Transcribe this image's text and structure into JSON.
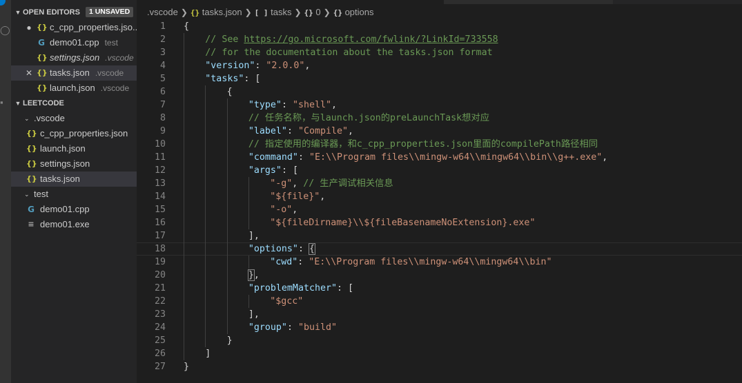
{
  "sidebar": {
    "open_editors": {
      "title": "OPEN EDITORS",
      "badge": "1 UNSAVED",
      "items": [
        {
          "label": "c_cpp_properties.jso...",
          "desc": ""
        },
        {
          "label": "demo01.cpp",
          "desc": "test"
        },
        {
          "label": "settings.json",
          "desc": ".vscode"
        },
        {
          "label": "tasks.json",
          "desc": ".vscode"
        },
        {
          "label": "launch.json",
          "desc": ".vscode"
        }
      ]
    },
    "workspace": {
      "title": "LEETCODE",
      "folders": [
        {
          "label": ".vscode",
          "files": [
            "c_cpp_properties.json",
            "launch.json",
            "settings.json",
            "tasks.json"
          ]
        },
        {
          "label": "test",
          "files": [
            "demo01.cpp",
            "demo01.exe"
          ]
        }
      ]
    }
  },
  "breadcrumbs": [
    ".vscode",
    "tasks.json",
    "tasks",
    "0",
    "options"
  ],
  "icons": {
    "json": "braces-icon",
    "cpp": "cpp-file-icon",
    "exe": "binary-file-icon",
    "array": "array-symbol-icon",
    "object": "object-symbol-icon"
  },
  "colors": {
    "key": "#9cdcfe",
    "string": "#ce9178",
    "comment": "#6a9955",
    "punctuation": "#d4d4d4",
    "json_icon": "#cbcb41",
    "cpp_icon": "#519aba"
  },
  "editor": {
    "current_line": 18,
    "lines": [
      [
        [
          "p",
          "{"
        ]
      ],
      [
        [
          "c",
          "// See "
        ],
        [
          "u",
          "https://go.microsoft.com/fwlink/?LinkId=733558"
        ]
      ],
      [
        [
          "c",
          "// for the documentation about the tasks.json format"
        ]
      ],
      [
        [
          "k",
          "\"version\""
        ],
        [
          "p",
          ": "
        ],
        [
          "s",
          "\"2.0.0\""
        ],
        [
          "p",
          ","
        ]
      ],
      [
        [
          "k",
          "\"tasks\""
        ],
        [
          "p",
          ": ["
        ]
      ],
      [
        [
          "p",
          "{"
        ]
      ],
      [
        [
          "k",
          "\"type\""
        ],
        [
          "p",
          ": "
        ],
        [
          "s",
          "\"shell\""
        ],
        [
          "p",
          ","
        ]
      ],
      [
        [
          "c",
          "// 任务名称，与launch.json的preLaunchTask想对应"
        ]
      ],
      [
        [
          "k",
          "\"label\""
        ],
        [
          "p",
          ": "
        ],
        [
          "s",
          "\"Compile\""
        ],
        [
          "p",
          ","
        ]
      ],
      [
        [
          "c",
          "// 指定使用的编译器，和c_cpp_properties.json里面的compilePath路径相同"
        ]
      ],
      [
        [
          "k",
          "\"command\""
        ],
        [
          "p",
          ": "
        ],
        [
          "s",
          "\"E:\\\\Program files\\\\mingw-w64\\\\mingw64\\\\bin\\\\g++.exe\""
        ],
        [
          "p",
          ","
        ]
      ],
      [
        [
          "k",
          "\"args\""
        ],
        [
          "p",
          ": ["
        ]
      ],
      [
        [
          "s",
          "\"-g\""
        ],
        [
          "p",
          ", "
        ],
        [
          "c",
          "// 生产调试相关信息"
        ]
      ],
      [
        [
          "s",
          "\"${file}\""
        ],
        [
          "p",
          ","
        ]
      ],
      [
        [
          "s",
          "\"-o\""
        ],
        [
          "p",
          ","
        ]
      ],
      [
        [
          "s",
          "\"${fileDirname}\\\\${fileBasenameNoExtension}.exe\""
        ]
      ],
      [
        [
          "p",
          "],"
        ]
      ],
      [
        [
          "k",
          "\"options\""
        ],
        [
          "p",
          ": "
        ],
        [
          "bm",
          "{"
        ]
      ],
      [
        [
          "k",
          "\"cwd\""
        ],
        [
          "p",
          ": "
        ],
        [
          "s",
          "\"E:\\\\Program files\\\\mingw-w64\\\\mingw64\\\\bin\""
        ]
      ],
      [
        [
          "bm",
          "}"
        ],
        [
          "p",
          ","
        ]
      ],
      [
        [
          "k",
          "\"problemMatcher\""
        ],
        [
          "p",
          ": ["
        ]
      ],
      [
        [
          "s",
          "\"$gcc\""
        ]
      ],
      [
        [
          "p",
          "],"
        ]
      ],
      [
        [
          "k",
          "\"group\""
        ],
        [
          "p",
          ": "
        ],
        [
          "s",
          "\"build\""
        ]
      ],
      [
        [
          "p",
          "}"
        ]
      ],
      [
        [
          "p",
          "]"
        ]
      ],
      [
        [
          "p",
          "}"
        ]
      ]
    ]
  }
}
